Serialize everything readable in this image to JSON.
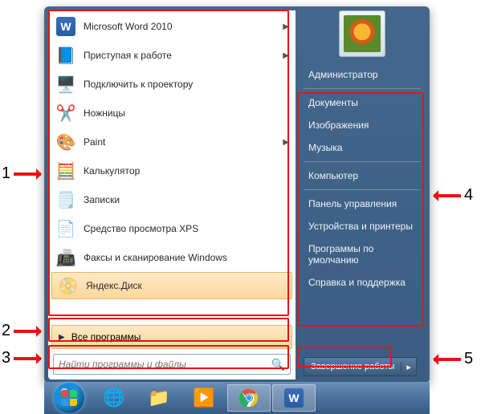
{
  "programs": [
    {
      "label": "Microsoft Word 2010",
      "icon": "word-icon",
      "submenu": true
    },
    {
      "label": "Приступая к работе",
      "icon": "getting-started-icon",
      "submenu": true
    },
    {
      "label": "Подключить к проектору",
      "icon": "projector-icon",
      "submenu": false
    },
    {
      "label": "Ножницы",
      "icon": "snip-icon",
      "submenu": false
    },
    {
      "label": "Paint",
      "icon": "paint-icon",
      "submenu": true
    },
    {
      "label": "Калькулятор",
      "icon": "calculator-icon",
      "submenu": false
    },
    {
      "label": "Записки",
      "icon": "sticky-notes-icon",
      "submenu": false
    },
    {
      "label": "Средство просмотра XPS",
      "icon": "xps-viewer-icon",
      "submenu": false
    },
    {
      "label": "Факсы и сканирование Windows",
      "icon": "fax-scan-icon",
      "submenu": false
    },
    {
      "label": "Яндекс.Диск",
      "icon": "yandex-disk-icon",
      "submenu": false,
      "highlight": true
    }
  ],
  "all_programs_label": "Все программы",
  "search_placeholder": "Найти программы и файлы",
  "user_name": "Администратор",
  "right_items": [
    "Документы",
    "Изображения",
    "Музыка",
    "Компьютер",
    "Панель управления",
    "Устройства и принтеры",
    "Программы по умолчанию",
    "Справка и поддержка"
  ],
  "shutdown_label": "Завершение работы",
  "annotations": {
    "1": "1",
    "2": "2",
    "3": "3",
    "4": "4",
    "5": "5"
  }
}
